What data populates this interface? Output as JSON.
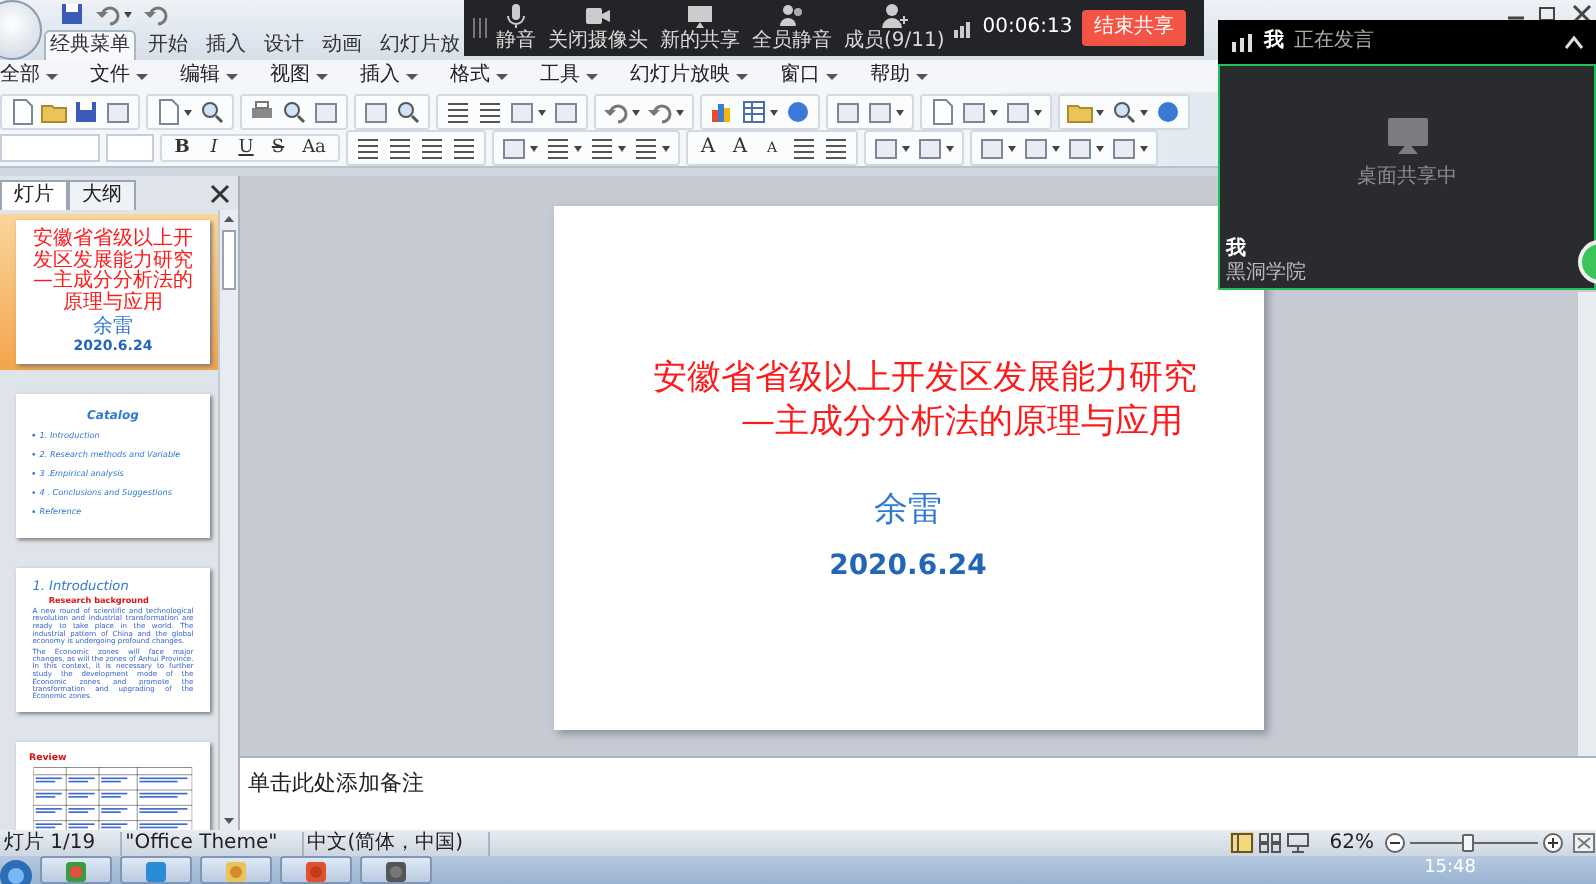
{
  "ribbon_tabs": [
    {
      "label": "经典菜单",
      "selected": true
    },
    {
      "label": "开始",
      "selected": false
    },
    {
      "label": "插入",
      "selected": false
    },
    {
      "label": "设计",
      "selected": false
    },
    {
      "label": "动画",
      "selected": false
    },
    {
      "label": "幻灯片放",
      "selected": false
    }
  ],
  "menu": [
    "全部",
    "文件",
    "编辑",
    "视图",
    "插入",
    "格式",
    "工具",
    "幻灯片放映",
    "窗口",
    "帮助"
  ],
  "format_buttons": [
    "B",
    "I",
    "U",
    "S",
    "Aa"
  ],
  "font_buttons": [
    "A",
    "A",
    "A"
  ],
  "meeting_bar": {
    "buttons": [
      {
        "label": "静音",
        "kind": "mic"
      },
      {
        "label": "关闭摄像头",
        "kind": "camera"
      },
      {
        "label": "新的共享",
        "kind": "share"
      },
      {
        "label": "全员静音",
        "kind": "group"
      },
      {
        "label": "成员(9/11)",
        "kind": "member"
      }
    ],
    "timer": "00:06:13",
    "end_button": "结束共享"
  },
  "video_panel": {
    "speaker": "我",
    "status": "正在发言",
    "message": "桌面共享中",
    "user": "我",
    "org": "黑洞学院"
  },
  "slide_panel": {
    "tabs": [
      {
        "label": "灯片",
        "selected": true
      },
      {
        "label": "大纲",
        "selected": false
      }
    ],
    "thumbnails": [
      {
        "kind": "title",
        "selected": true,
        "title": "安徽省省级以上开发区发展能力研究",
        "subtitle": "—主成分分析法的原理与应用",
        "author": "余雷",
        "date": "2020.6.24"
      },
      {
        "kind": "list",
        "selected": false,
        "title": "Catalog",
        "items": [
          "1. Introduction",
          "2. Research methods and Variable",
          "3 .Empirical analysis",
          "4 . Conclusions and Suggestions",
          "Reference"
        ]
      },
      {
        "kind": "text",
        "selected": false,
        "title": "1. Introduction",
        "subtitle": "Research background",
        "paragraphs": [
          "A new round of scientific and technological revolution and industrial transformation are ready to take place in the world. The industrial pattern of China and the global economy is undergoing profound changes.",
          "The Economic zones will face major changes, as will the zones of Anhui Province. In this context, it is necessary to further study the development mode of the Economic zones and promote the transformation and upgrading of the Economic zones."
        ]
      },
      {
        "kind": "table",
        "selected": false,
        "title": "Review"
      }
    ]
  },
  "slide": {
    "kind": "title",
    "title": "安徽省省级以上开发区发展能力研究",
    "subtitle": "—主成分分析法的原理与应用",
    "author": "余雷",
    "date": "2020.6.24"
  },
  "notes": {
    "prompt": "单击此处添加备注"
  },
  "status_bar": {
    "slide": "灯片 1/19",
    "theme": "\"Office Theme\"",
    "language": "中文(简体，中国)",
    "views": [
      {
        "kind": "normal",
        "selected": true
      },
      {
        "kind": "sorter",
        "selected": false
      },
      {
        "kind": "show",
        "selected": false
      }
    ],
    "zoom": {
      "reading": "62%",
      "level": 0.45
    }
  },
  "taskbar": {
    "clock": "15:48"
  }
}
